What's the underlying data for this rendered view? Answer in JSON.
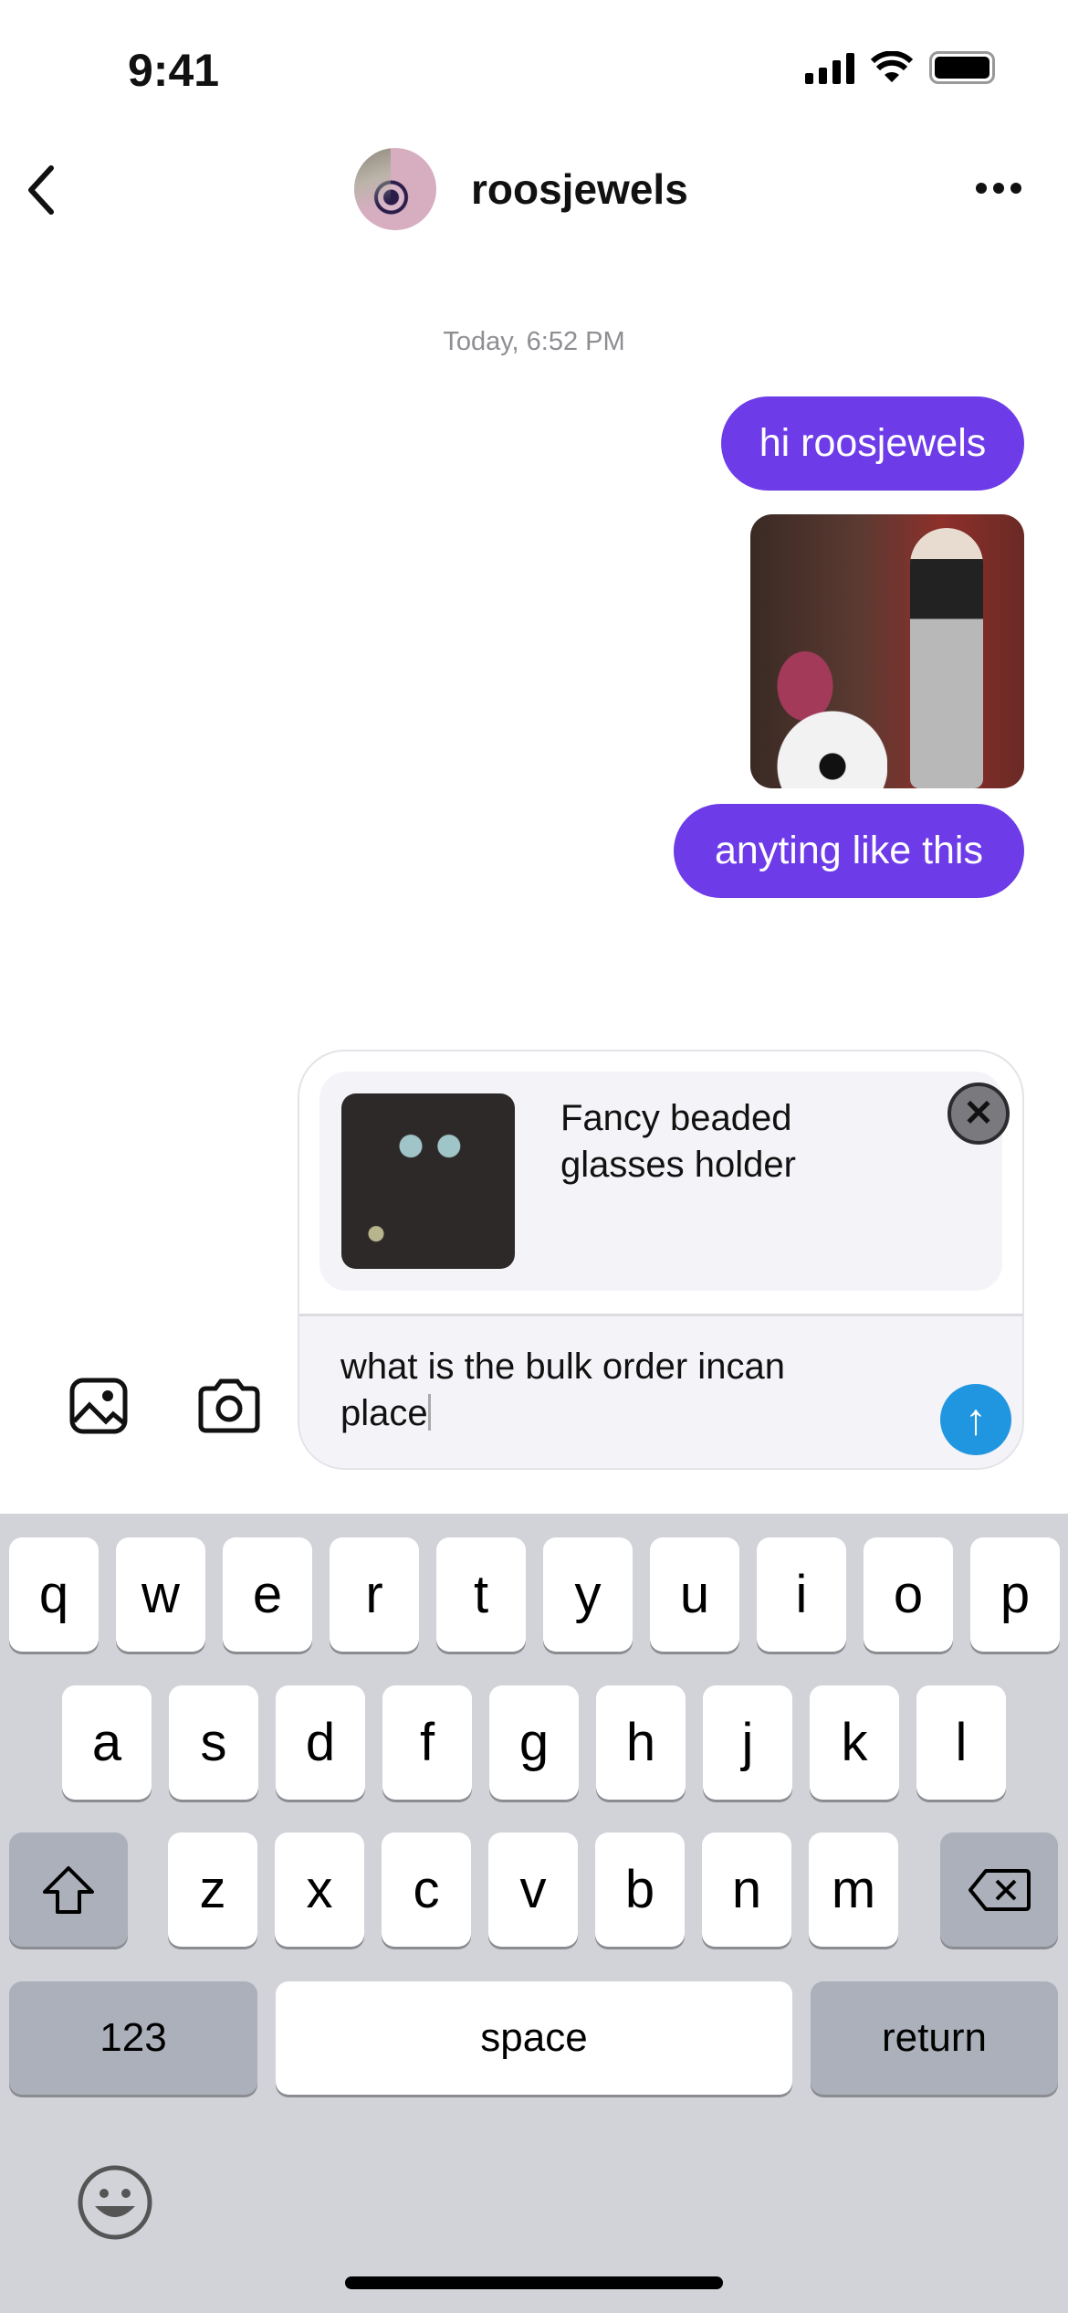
{
  "status_bar": {
    "time": "9:41"
  },
  "header": {
    "username": "roosjewels",
    "back_icon": "chevron-left-icon",
    "more_icon": "ellipsis-icon"
  },
  "conversation": {
    "timestamp": "Today, 6:52 PM",
    "messages": [
      {
        "type": "text",
        "text": "hi roosjewels"
      },
      {
        "type": "image"
      },
      {
        "type": "text",
        "text": "anyting like this"
      }
    ],
    "bubble_color": "#6d3be8"
  },
  "composer": {
    "product": {
      "title_line1": "Fancy beaded",
      "title_line2": "glasses holder"
    },
    "input_value": "what is the bulk order incan place",
    "send_color": "#2196e0"
  },
  "keyboard": {
    "row1": [
      "q",
      "w",
      "e",
      "r",
      "t",
      "y",
      "u",
      "i",
      "o",
      "p"
    ],
    "row2": [
      "a",
      "s",
      "d",
      "f",
      "g",
      "h",
      "j",
      "k",
      "l"
    ],
    "row3": [
      "z",
      "x",
      "c",
      "v",
      "b",
      "n",
      "m"
    ],
    "numbers": "123",
    "space": "space",
    "return": "return"
  }
}
